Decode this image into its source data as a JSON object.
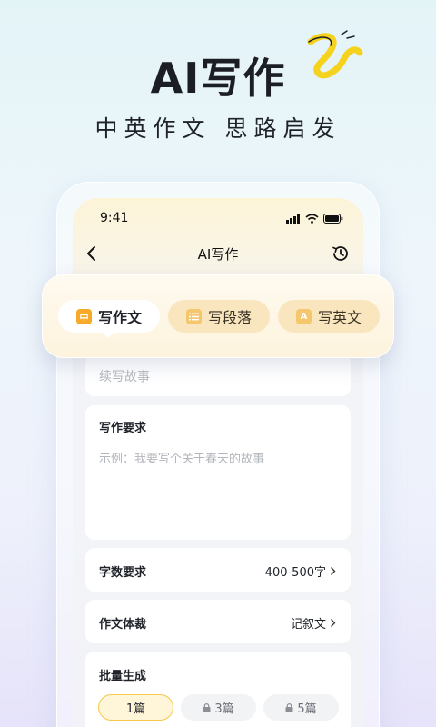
{
  "hero": {
    "title": "AI写作",
    "subtitle": "中英作文 思路启发"
  },
  "status_bar": {
    "time": "9:41"
  },
  "nav": {
    "title": "AI写作"
  },
  "tabs": [
    {
      "label": "写作文",
      "icon_text": "中",
      "icon": "chinese-char-icon",
      "active": true
    },
    {
      "label": "写段落",
      "icon": "list-icon",
      "active": false
    },
    {
      "label": "写英文",
      "icon_text": "A",
      "icon": "letter-a-icon",
      "active": false
    }
  ],
  "continue_story": {
    "placeholder": "续写故事"
  },
  "requirement": {
    "label": "写作要求",
    "placeholder": "示例：我要写个关于春天的故事"
  },
  "word_count": {
    "label": "字数要求",
    "value": "400-500字"
  },
  "genre": {
    "label": "作文体裁",
    "value": "记叙文"
  },
  "batch": {
    "label": "批量生成",
    "options": [
      {
        "label": "1篇",
        "locked": false,
        "selected": true
      },
      {
        "label": "3篇",
        "locked": true,
        "selected": false
      },
      {
        "label": "5篇",
        "locked": true,
        "selected": false
      }
    ]
  },
  "colors": {
    "accent": "#f7a928",
    "swirl": "#f5d21e",
    "tab_inactive": "#f9e6bf"
  }
}
